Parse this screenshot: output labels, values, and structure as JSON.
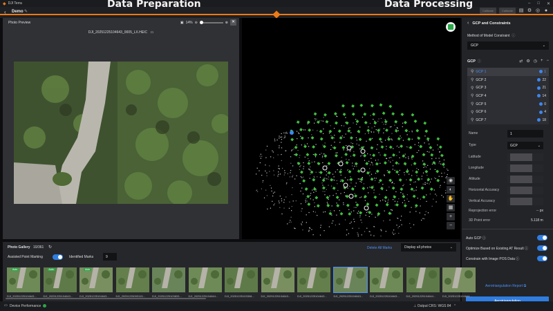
{
  "app": {
    "title": "DJI Terra",
    "project": "Demo"
  },
  "steps": {
    "prep": "Data Preparation",
    "process": "Data Processing"
  },
  "topbar": {
    "btn1": "Calibrate",
    "btn2": "Calibrate"
  },
  "preview": {
    "title": "Photo Preview",
    "zoom": "14%",
    "filename": "DJI_20251225104643_0005_LX.HEIC"
  },
  "panel": {
    "title": "GCP and Constraints",
    "method_label": "Method of Model Constraint",
    "method_value": "GCP",
    "gcp_header": "GCP",
    "gcps": [
      {
        "name": "GCP",
        "num": "1",
        "count": "1"
      },
      {
        "name": "GCP",
        "num": "2",
        "count": "22"
      },
      {
        "name": "GCP",
        "num": "3",
        "count": "21"
      },
      {
        "name": "GCP",
        "num": "4",
        "count": "14"
      },
      {
        "name": "GCP",
        "num": "5",
        "count": "0"
      },
      {
        "name": "GCP",
        "num": "6",
        "count": "4"
      },
      {
        "name": "GCP",
        "num": "7",
        "count": "18"
      }
    ],
    "fields": {
      "name_label": "Name",
      "name_value": "1",
      "type_label": "Type",
      "type_value": "GCP",
      "lat_label": "Latitude",
      "lon_label": "Longitude",
      "alt_label": "Altitude",
      "hacc_label": "Horizontal Accuracy",
      "vacc_label": "Vertical Accuracy",
      "reproj_label": "Reprojection error",
      "reproj_value": "-- px",
      "pt3d_label": "3D Point error",
      "pt3d_value": "5.118 m"
    },
    "toggles": {
      "auto_gcp": "Auto GCP",
      "optimize": "Optimize Based on Existing AT Result",
      "constrain": "Constrain with Image POS Data"
    },
    "report_link": "Aerotriangulation Report",
    "main_button": "Aerotriangulation"
  },
  "gallery": {
    "title": "Photo Gallery",
    "count": "10/361",
    "assisted_label": "Assisted Point Marking",
    "identified_label": "Identified Marks",
    "identified_value": "9",
    "delete_all": "Delete All Marks",
    "filter_value": "Display all photos",
    "thumbs": [
      {
        "label": "DJI_20251225104643...",
        "auto": "Auto"
      },
      {
        "label": "DJI_20251225104643...",
        "auto": "Auto"
      },
      {
        "label": "DJI_20251225104643...",
        "auto": "Auto"
      },
      {
        "label": "DJI_20251225093115...",
        "auto": ""
      },
      {
        "label": "DJI_20251225103833...",
        "auto": ""
      },
      {
        "label": "DJI_20251225104644...",
        "auto": ""
      },
      {
        "label": "DJI_20251225103308...",
        "auto": ""
      },
      {
        "label": "DJI_20251225104643...",
        "auto": ""
      },
      {
        "label": "DJI_20251225104643...",
        "auto": ""
      },
      {
        "label": "DJI_20251225104643...",
        "auto": ""
      },
      {
        "label": "DJI_20251225104643...",
        "auto": ""
      },
      {
        "label": "DJI_20251225104644...",
        "auto": ""
      },
      {
        "label": "DJI_20251225104644...",
        "auto": ""
      }
    ]
  },
  "status": {
    "device": "Device Performance",
    "crs": "Output CRS: WGS 84"
  }
}
